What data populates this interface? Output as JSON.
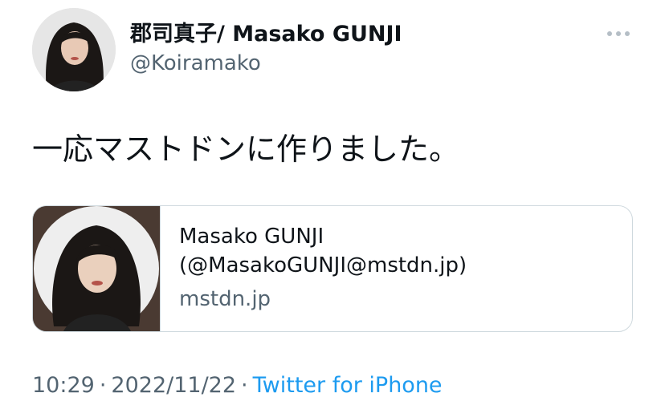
{
  "tweet": {
    "author": {
      "display_name": "郡司真子/ Masako GUNJI",
      "handle": "@Koiramako",
      "avatar_icon": "profile-photo"
    },
    "more_icon": "more-horizontal-icon",
    "text": "一応マストドンに作りました。",
    "link_card": {
      "title_line1": "Masako GUNJI",
      "title_line2": "(@MasakoGUNJI@mstdn.jp)",
      "domain": "mstdn.jp"
    },
    "meta": {
      "time": "10:29",
      "separator": "·",
      "date": "2022/11/22",
      "source": "Twitter for iPhone"
    }
  },
  "colors": {
    "text_primary": "#0f1419",
    "text_secondary": "#536471",
    "link": "#1d9bf0",
    "border": "#cfd9de"
  }
}
